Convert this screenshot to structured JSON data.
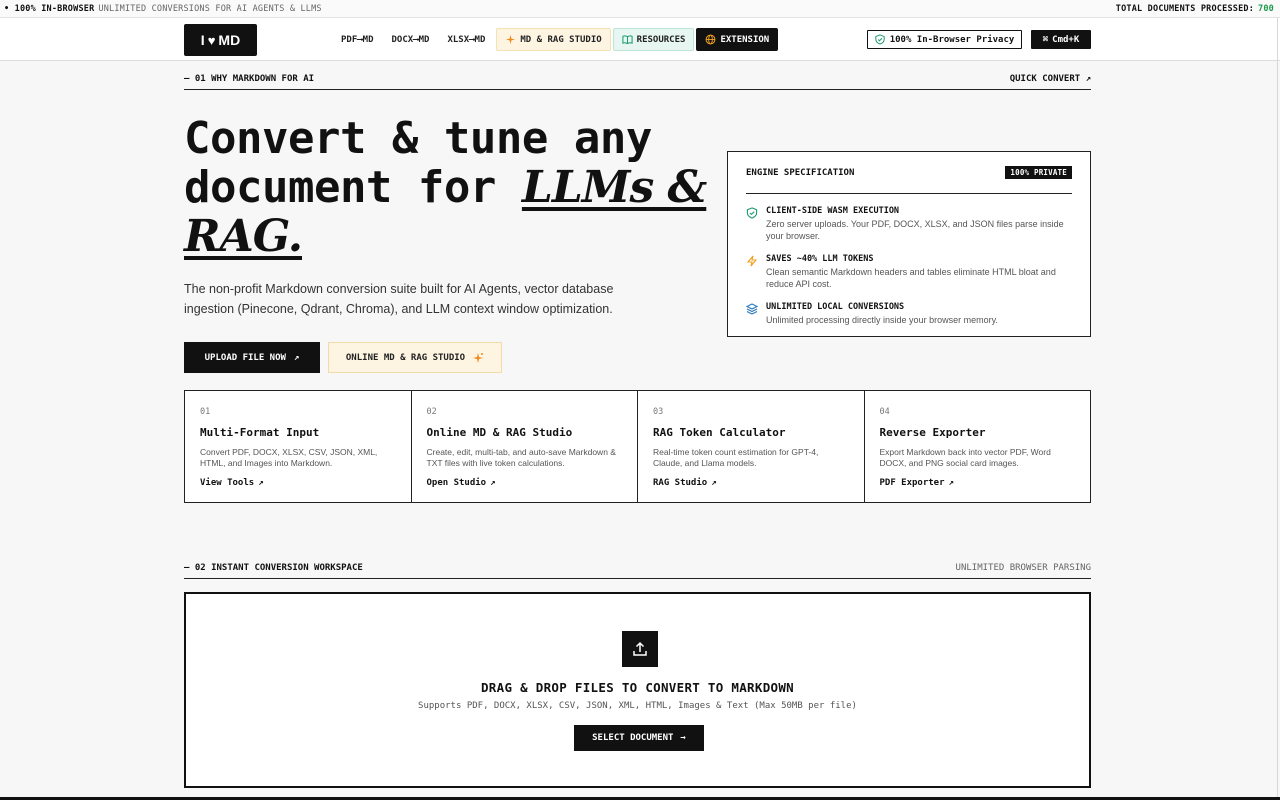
{
  "ticker": {
    "left_bold": "• 100% IN-BROWSER",
    "left_sub": "UNLIMITED CONVERSIONS FOR AI AGENTS & LLMS",
    "right_label": "TOTAL DOCUMENTS PROCESSED:",
    "right_count": "700"
  },
  "nav": {
    "logo_i": "I",
    "logo_heart": "♥",
    "logo_md": "MD",
    "links": [
      "PDF⟶MD",
      "DOCX⟶MD",
      "XLSX⟶MD"
    ],
    "studio": "MD & RAG STUDIO",
    "resources": "RESOURCES",
    "extension": "EXTENSION",
    "privacy": "100% In-Browser Privacy",
    "cmdk": "Cmd+K"
  },
  "section1": {
    "label": "— 01 WHY MARKDOWN FOR AI",
    "action": "QUICK CONVERT ↗"
  },
  "hero": {
    "line1": "Convert & tune any",
    "line2_a": "document for ",
    "line2_em": "LLMs &",
    "line3_em": "RAG.",
    "desc": "The non-profit Markdown conversion suite built for AI Agents, vector database ingestion (Pinecone, Qdrant, Chroma), and LLM context window optimization.",
    "upload_btn": "UPLOAD FILE NOW",
    "studio_btn": "ONLINE MD & RAG STUDIO"
  },
  "spec": {
    "title": "ENGINE SPECIFICATION",
    "badge": "100% PRIVATE",
    "items": [
      {
        "title": "CLIENT-SIDE WASM EXECUTION",
        "desc": "Zero server uploads. Your PDF, DOCX, XLSX, and JSON files parse inside your browser.",
        "icon": "shield-check-icon",
        "color": "#1a9a6a"
      },
      {
        "title": "SAVES ~40% LLM TOKENS",
        "desc": "Clean semantic Markdown headers and tables eliminate HTML bloat and reduce API cost.",
        "icon": "lightning-icon",
        "color": "#f0a020"
      },
      {
        "title": "UNLIMITED LOCAL CONVERSIONS",
        "desc": "Unlimited processing directly inside your browser memory.",
        "icon": "layers-icon",
        "color": "#2a7ac0"
      }
    ]
  },
  "features": [
    {
      "num": "01",
      "title": "Multi-Format Input",
      "desc": "Convert PDF, DOCX, XLSX, CSV, JSON, XML, HTML, and Images into Markdown.",
      "link": "View Tools"
    },
    {
      "num": "02",
      "title": "Online MD & RAG Studio",
      "desc": "Create, edit, multi-tab, and auto-save Markdown & TXT files with live token calculations.",
      "link": "Open Studio"
    },
    {
      "num": "03",
      "title": "RAG Token Calculator",
      "desc": "Real-time token count estimation for GPT-4, Claude, and Llama models.",
      "link": "RAG Studio"
    },
    {
      "num": "04",
      "title": "Reverse Exporter",
      "desc": "Export Markdown back into vector PDF, Word DOCX, and PNG social card images.",
      "link": "PDF Exporter"
    }
  ],
  "section2": {
    "label": "— 02 INSTANT CONVERSION WORKSPACE",
    "action": "UNLIMITED BROWSER PARSING"
  },
  "dropzone": {
    "title": "DRAG & DROP FILES TO CONVERT TO MARKDOWN",
    "sub": "Supports PDF, DOCX, XLSX, CSV, JSON, XML, HTML, Images & Text (Max 50MB per file)",
    "button": "SELECT DOCUMENT"
  },
  "colors": {
    "accent_green": "#1a9a4a",
    "studio_bg": "#fdf5e2",
    "resources_bg": "#e7f6f0"
  }
}
